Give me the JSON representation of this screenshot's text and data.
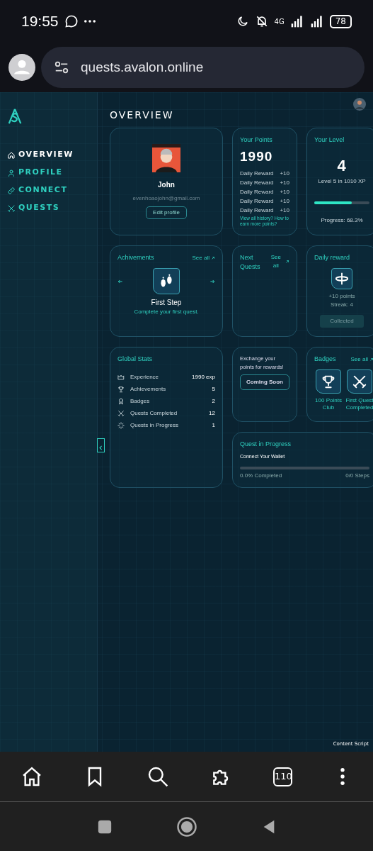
{
  "status_bar": {
    "time": "19:55",
    "network": "4G",
    "battery": "78"
  },
  "browser": {
    "url": "quests.avalon.online",
    "tab_count": "110"
  },
  "sidebar": {
    "items": [
      {
        "kind": "home",
        "label": "OVERVIEW",
        "selected": true
      },
      {
        "kind": "person",
        "label": "PROFILE",
        "selected": false
      },
      {
        "kind": "link",
        "label": "CONNECT",
        "selected": false
      },
      {
        "kind": "swords",
        "label": "QUESTS",
        "selected": false
      }
    ]
  },
  "page_title": "OVERVIEW",
  "profile": {
    "name": "John",
    "email": "evenhoaojohn@gmail.com",
    "button": "Edit profile"
  },
  "points": {
    "title": "Your Points",
    "total": "1990",
    "rows": [
      {
        "label": "Daily Reward",
        "value": "+10"
      },
      {
        "label": "Daily Reward",
        "value": "+10"
      },
      {
        "label": "Daily Reward",
        "value": "+10"
      },
      {
        "label": "Daily Reward",
        "value": "+10"
      },
      {
        "label": "Daily Reward",
        "value": "+10"
      }
    ],
    "link": "View all history? How to earn more points?"
  },
  "level": {
    "title": "Your Level",
    "number": "4",
    "next": "Level 5 in 1010 XP",
    "level": 0.683,
    "progress": "Progress: 68.3%"
  },
  "achievements": {
    "title": "Achivements",
    "see_all": "See all",
    "name": "First Step",
    "description": "Complete your first quest."
  },
  "next_quests": {
    "title": "Next Quests",
    "see_all": "See all"
  },
  "daily_reward": {
    "title": "Daily reward",
    "points": "+10 points",
    "streak": "Streak: 4",
    "button": "Collected",
    "disabled": true
  },
  "global_stats": {
    "title": "Global Stats",
    "rows": [
      {
        "kind": "crown",
        "label": "Experience",
        "value": "1990 exp"
      },
      {
        "kind": "trophy",
        "label": "Achievements",
        "value": "5"
      },
      {
        "kind": "medal",
        "label": "Badges",
        "value": "2"
      },
      {
        "kind": "swords",
        "label": "Quests Completed",
        "value": "12"
      },
      {
        "kind": "spinner",
        "label": "Quests in Progress",
        "value": "1"
      }
    ]
  },
  "exchange": {
    "text": "Exchange your points for rewards!",
    "button": "Coming Soon"
  },
  "badges": {
    "title": "Badges",
    "see_all": "See all",
    "items": [
      {
        "kind": "trophy",
        "name": "100 Points Club"
      },
      {
        "kind": "swords",
        "name": "First Quest Completed"
      }
    ]
  },
  "quest_in_progress": {
    "title": "Quest in Progress",
    "quest": "Connect Your Wallet",
    "level": 0,
    "completed": "0.0% Completed",
    "steps": "0/0 Steps"
  },
  "footer_label": "Content Script"
}
